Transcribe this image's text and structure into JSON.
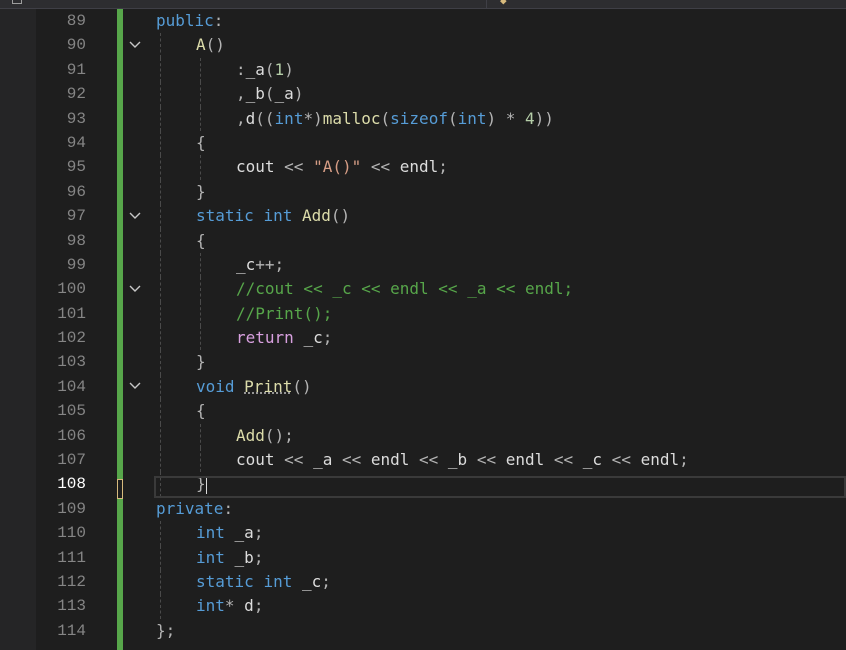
{
  "editor": {
    "current_line": "108",
    "lines": [
      {
        "num": "89",
        "fold": "",
        "indent": 0,
        "tokens": [
          {
            "t": "public",
            "c": "kw"
          },
          {
            "t": ":",
            "c": "op"
          }
        ]
      },
      {
        "num": "90",
        "fold": "chevron",
        "indent": 1,
        "tokens": [
          {
            "t": "A",
            "c": "fn"
          },
          {
            "t": "()",
            "c": "op"
          }
        ]
      },
      {
        "num": "91",
        "fold": "",
        "indent": 2,
        "tokens": [
          {
            "t": ":",
            "c": "op"
          },
          {
            "t": "_a",
            "c": "var"
          },
          {
            "t": "(",
            "c": "op"
          },
          {
            "t": "1",
            "c": "num"
          },
          {
            "t": ")",
            "c": "op"
          }
        ]
      },
      {
        "num": "92",
        "fold": "",
        "indent": 2,
        "tokens": [
          {
            "t": ",",
            "c": "op"
          },
          {
            "t": "_b",
            "c": "var"
          },
          {
            "t": "(",
            "c": "op"
          },
          {
            "t": "_a",
            "c": "var"
          },
          {
            "t": ")",
            "c": "op"
          }
        ]
      },
      {
        "num": "93",
        "fold": "",
        "indent": 2,
        "tokens": [
          {
            "t": ",",
            "c": "op"
          },
          {
            "t": "d",
            "c": "var"
          },
          {
            "t": "((",
            "c": "op"
          },
          {
            "t": "int",
            "c": "kw"
          },
          {
            "t": "*)",
            "c": "op"
          },
          {
            "t": "malloc",
            "c": "fn"
          },
          {
            "t": "(",
            "c": "op"
          },
          {
            "t": "sizeof",
            "c": "kw"
          },
          {
            "t": "(",
            "c": "op"
          },
          {
            "t": "int",
            "c": "kw"
          },
          {
            "t": ") * ",
            "c": "op"
          },
          {
            "t": "4",
            "c": "num"
          },
          {
            "t": "))",
            "c": "op"
          }
        ]
      },
      {
        "num": "94",
        "fold": "",
        "indent": 1,
        "tokens": [
          {
            "t": "{",
            "c": "op"
          }
        ]
      },
      {
        "num": "95",
        "fold": "",
        "indent": 2,
        "tokens": [
          {
            "t": "cout",
            "c": "var"
          },
          {
            "t": " << ",
            "c": "op"
          },
          {
            "t": "\"A()\"",
            "c": "str"
          },
          {
            "t": " << ",
            "c": "op"
          },
          {
            "t": "endl",
            "c": "var"
          },
          {
            "t": ";",
            "c": "op"
          }
        ]
      },
      {
        "num": "96",
        "fold": "",
        "indent": 1,
        "tokens": [
          {
            "t": "}",
            "c": "op"
          }
        ]
      },
      {
        "num": "97",
        "fold": "chevron",
        "indent": 1,
        "tokens": [
          {
            "t": "static",
            "c": "kw"
          },
          {
            "t": " ",
            "c": "op"
          },
          {
            "t": "int",
            "c": "kw"
          },
          {
            "t": " ",
            "c": "op"
          },
          {
            "t": "Add",
            "c": "fn"
          },
          {
            "t": "()",
            "c": "op"
          }
        ]
      },
      {
        "num": "98",
        "fold": "",
        "indent": 1,
        "tokens": [
          {
            "t": "{",
            "c": "op"
          }
        ]
      },
      {
        "num": "99",
        "fold": "",
        "indent": 2,
        "tokens": [
          {
            "t": "_c",
            "c": "var"
          },
          {
            "t": "++;",
            "c": "op"
          }
        ]
      },
      {
        "num": "100",
        "fold": "chevron",
        "indent": 2,
        "tokens": [
          {
            "t": "//cout << _c << endl << _a << endl;",
            "c": "cmt"
          }
        ]
      },
      {
        "num": "101",
        "fold": "",
        "indent": 2,
        "tokens": [
          {
            "t": "//Print();",
            "c": "cmt"
          }
        ]
      },
      {
        "num": "102",
        "fold": "",
        "indent": 2,
        "tokens": [
          {
            "t": "return",
            "c": "ctl"
          },
          {
            "t": " ",
            "c": "op"
          },
          {
            "t": "_c",
            "c": "var"
          },
          {
            "t": ";",
            "c": "op"
          }
        ]
      },
      {
        "num": "103",
        "fold": "",
        "indent": 1,
        "tokens": [
          {
            "t": "}",
            "c": "op"
          }
        ]
      },
      {
        "num": "104",
        "fold": "chevron",
        "indent": 1,
        "tokens": [
          {
            "t": "void",
            "c": "kw"
          },
          {
            "t": " ",
            "c": "op"
          },
          {
            "t": "Print",
            "c": "fn squig"
          },
          {
            "t": "()",
            "c": "op"
          }
        ]
      },
      {
        "num": "105",
        "fold": "",
        "indent": 1,
        "tokens": [
          {
            "t": "{",
            "c": "op"
          }
        ]
      },
      {
        "num": "106",
        "fold": "",
        "indent": 2,
        "tokens": [
          {
            "t": "Add",
            "c": "fn"
          },
          {
            "t": "();",
            "c": "op"
          }
        ]
      },
      {
        "num": "107",
        "fold": "",
        "indent": 2,
        "tokens": [
          {
            "t": "cout",
            "c": "var"
          },
          {
            "t": " << ",
            "c": "op"
          },
          {
            "t": "_a",
            "c": "var"
          },
          {
            "t": " << ",
            "c": "op"
          },
          {
            "t": "endl",
            "c": "var"
          },
          {
            "t": " << ",
            "c": "op"
          },
          {
            "t": "_b",
            "c": "var"
          },
          {
            "t": " << ",
            "c": "op"
          },
          {
            "t": "endl",
            "c": "var"
          },
          {
            "t": " << ",
            "c": "op"
          },
          {
            "t": "_c",
            "c": "var"
          },
          {
            "t": " << ",
            "c": "op"
          },
          {
            "t": "endl",
            "c": "var"
          },
          {
            "t": ";",
            "c": "op"
          }
        ]
      },
      {
        "num": "108",
        "fold": "",
        "indent": 1,
        "tokens": [
          {
            "t": "}",
            "c": "op"
          }
        ],
        "cursor": true
      },
      {
        "num": "109",
        "fold": "",
        "indent": 0,
        "tokens": [
          {
            "t": "private",
            "c": "kw"
          },
          {
            "t": ":",
            "c": "op"
          }
        ]
      },
      {
        "num": "110",
        "fold": "",
        "indent": 1,
        "tokens": [
          {
            "t": "int",
            "c": "kw"
          },
          {
            "t": " ",
            "c": "op"
          },
          {
            "t": "_a",
            "c": "var"
          },
          {
            "t": ";",
            "c": "op"
          }
        ]
      },
      {
        "num": "111",
        "fold": "",
        "indent": 1,
        "tokens": [
          {
            "t": "int",
            "c": "kw"
          },
          {
            "t": " ",
            "c": "op"
          },
          {
            "t": "_b",
            "c": "var"
          },
          {
            "t": ";",
            "c": "op"
          }
        ]
      },
      {
        "num": "112",
        "fold": "",
        "indent": 1,
        "tokens": [
          {
            "t": "static",
            "c": "kw"
          },
          {
            "t": " ",
            "c": "op"
          },
          {
            "t": "int",
            "c": "kw"
          },
          {
            "t": " ",
            "c": "op"
          },
          {
            "t": "_c",
            "c": "var"
          },
          {
            "t": ";",
            "c": "op"
          }
        ]
      },
      {
        "num": "113",
        "fold": "",
        "indent": 1,
        "tokens": [
          {
            "t": "int",
            "c": "kw"
          },
          {
            "t": "* ",
            "c": "op"
          },
          {
            "t": "d",
            "c": "var"
          },
          {
            "t": ";",
            "c": "op"
          }
        ]
      },
      {
        "num": "114",
        "fold": "",
        "indent": 0,
        "tokens": [
          {
            "t": "};",
            "c": "op"
          }
        ]
      }
    ]
  },
  "colors": {
    "background": "#1e1e1e",
    "keyword": "#569cd6",
    "control_keyword": "#d8a0df",
    "function": "#dcdcaa",
    "string": "#d69d85",
    "comment": "#57a64a",
    "number": "#b5cea8",
    "change_bar": "#57a64a",
    "line_number": "#858585"
  }
}
